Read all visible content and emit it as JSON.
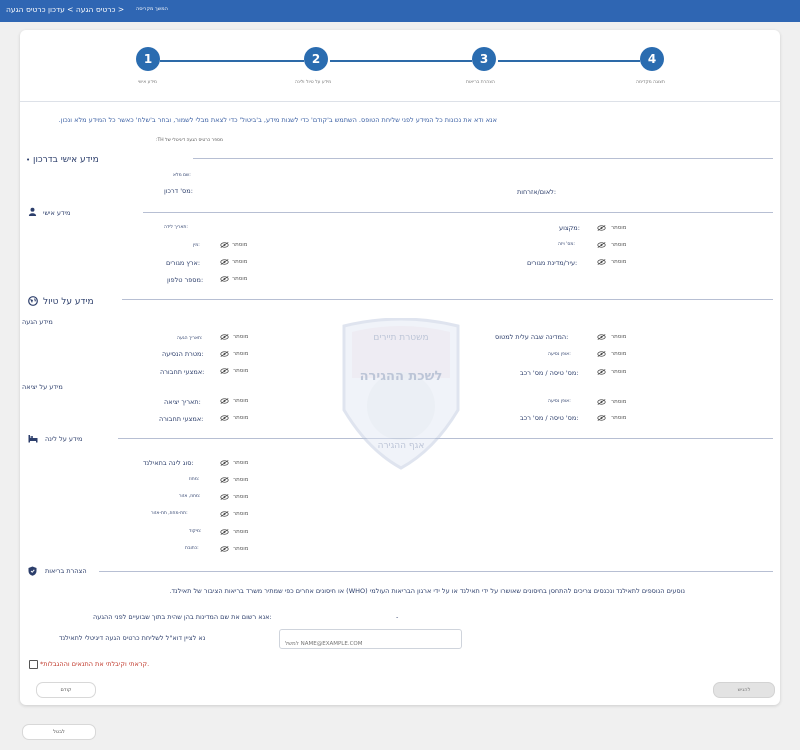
{
  "header": {
    "breadcrumb": "כרטיס הגעה > עדכון כרטיס הגעה >",
    "note": "המשך מקריסה"
  },
  "steps": [
    {
      "num": "1",
      "label": "מידע אישי"
    },
    {
      "num": "2",
      "label": "מידע על טיול ולינה"
    },
    {
      "num": "3",
      "label": "הצהרת בריאות"
    },
    {
      "num": "4",
      "label": "תצוגה מקדימה"
    }
  ],
  "notice": "אנא ודא את נכונות כל המידע לפני שליחת הטופס. השתמש ב'קודם' כדי לשנות מידע, ב'ביטול' כדי לצאת מבלי לשמור, ובחר ב'שלח' כאשר כל המידע מלא ונכון.",
  "card_number_label": "מספר כרטיס הגעה דיגיטלי של TH:",
  "passport": {
    "title": "מידע אישי בדרכון",
    "full_name_label": "שם מלא:",
    "passport_no_label": "מס' דרכון:",
    "nationality_label": "לאום/אזרחות:"
  },
  "hidden_text": "מוסתר",
  "personal": {
    "title": "מידע אישי",
    "birth_date": "תאריך לידה:",
    "gender": "מין:",
    "country_of_residence": "ארץ מגורים:",
    "phone": "מספר טלפון:",
    "occupation": "מקצוע:",
    "visa_no": "מס' ויזה:",
    "city_of_residence": "עיר/מדינת מגורים:"
  },
  "travel": {
    "title": "מידע על טיול",
    "arrival_subtitle": "מידע הגעה",
    "departure_subtitle": "מידע על יציאה",
    "arrival_date": "תאריך הגעה:",
    "purpose": "מטרת הנסיעה:",
    "transport": "אמצעי תחבורה:",
    "boarding_country": "המדינה שבה עלית למטוס:",
    "mode_of_travel": "אופן נסיעה:",
    "flight_no": "מס' טיסה / מס' רכב:",
    "departure_date": "תאריך יציאה:",
    "departure_transport": "אמצעי תחבורה:",
    "departure_mode": "אופן נסיעה:",
    "departure_flight_no": "מס' טיסה / מס' רכב:"
  },
  "accommodation": {
    "title": "מידע על לינה",
    "type": "סוג לינה בתאילנד:",
    "province": "מחוז:",
    "district": "מחוז, אזור:",
    "subdistrict": "תת-מחוז, תת-אזור:",
    "postcode": "מיקוד:",
    "address": "כתובת:"
  },
  "health": {
    "title": "הצהרת בריאות",
    "paragraph": "נוסעים הנוספים לתאילנד ונכנסים צריכים להתחסן בחיסונים שאושרו על ידי תאילנד או על ידי ארגון הבריאות העולמי (WHO) או חיסונים אחרים כפי שמתיר משרד בריאות הציבור של תאילנד.",
    "countries_label": "אנא רשום את שם המדינות בהן שהית בתוך שבועיים לפני ההגעה:",
    "countries_value": "-",
    "email_label": "נא לציין דוא\"ל לשליחת כרטיס הגעה דיגיטלי לתאילנד",
    "email_placeholder": "למשל NAME@EXAMPLE.COM",
    "accept_label": "*קראתי וקיבלתי את התנאים וההגבלות."
  },
  "buttons": {
    "submit": "להגיש",
    "previous": "קודם",
    "cancel": "לבטל"
  },
  "watermark": {
    "top": "משטרת תיירים",
    "middle": "לשכת ההגירה",
    "bottom": "אגף ההגירה"
  },
  "colors": {
    "primary": "#2f66b3",
    "text": "#2c3e6b",
    "error": "#c0392b"
  }
}
